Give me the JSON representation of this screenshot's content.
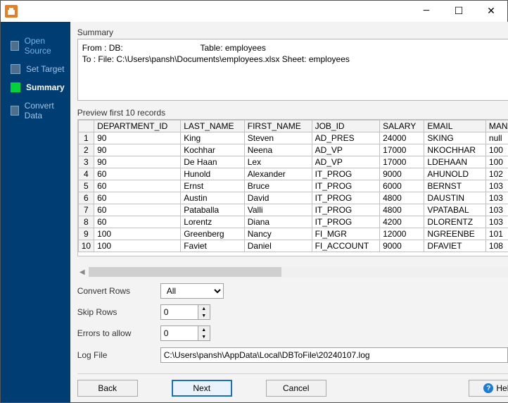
{
  "sidebar": {
    "items": [
      {
        "label": "Open Source"
      },
      {
        "label": "Set Target"
      },
      {
        "label": "Summary"
      },
      {
        "label": "Convert Data"
      }
    ],
    "current": 2
  },
  "summary": {
    "title": "Summary",
    "from_line": "From : DB:                                 Table: employees",
    "to_line": "To : File: C:\\Users\\pansh\\Documents\\employees.xlsx Sheet: employees"
  },
  "preview": {
    "title": "Preview first 10 records",
    "columns": [
      "DEPARTMENT_ID",
      "LAST_NAME",
      "FIRST_NAME",
      "JOB_ID",
      "SALARY",
      "EMAIL",
      "MANAG"
    ],
    "rows": [
      [
        "90",
        "King",
        "Steven",
        "AD_PRES",
        "24000",
        "SKING",
        "null"
      ],
      [
        "90",
        "Kochhar",
        "Neena",
        "AD_VP",
        "17000",
        "NKOCHHAR",
        "100"
      ],
      [
        "90",
        "De Haan",
        "Lex",
        "AD_VP",
        "17000",
        "LDEHAAN",
        "100"
      ],
      [
        "60",
        "Hunold",
        "Alexander",
        "IT_PROG",
        "9000",
        "AHUNOLD",
        "102"
      ],
      [
        "60",
        "Ernst",
        "Bruce",
        "IT_PROG",
        "6000",
        "BERNST",
        "103"
      ],
      [
        "60",
        "Austin",
        "David",
        "IT_PROG",
        "4800",
        "DAUSTIN",
        "103"
      ],
      [
        "60",
        "Pataballa",
        "Valli",
        "IT_PROG",
        "4800",
        "VPATABAL",
        "103"
      ],
      [
        "60",
        "Lorentz",
        "Diana",
        "IT_PROG",
        "4200",
        "DLORENTZ",
        "103"
      ],
      [
        "100",
        "Greenberg",
        "Nancy",
        "FI_MGR",
        "12000",
        "NGREENBE",
        "101"
      ],
      [
        "100",
        "Faviet",
        "Daniel",
        "FI_ACCOUNT",
        "9000",
        "DFAVIET",
        "108"
      ]
    ]
  },
  "form": {
    "convert_rows_label": "Convert Rows",
    "convert_rows_value": "All",
    "skip_rows_label": "Skip Rows",
    "skip_rows_value": "0",
    "errors_label": "Errors to allow",
    "errors_value": "0",
    "log_label": "Log File",
    "log_value": "C:\\Users\\pansh\\AppData\\Local\\DBToFile\\20240107.log"
  },
  "buttons": {
    "back": "Back",
    "next": "Next",
    "cancel": "Cancel",
    "help": "Help"
  }
}
